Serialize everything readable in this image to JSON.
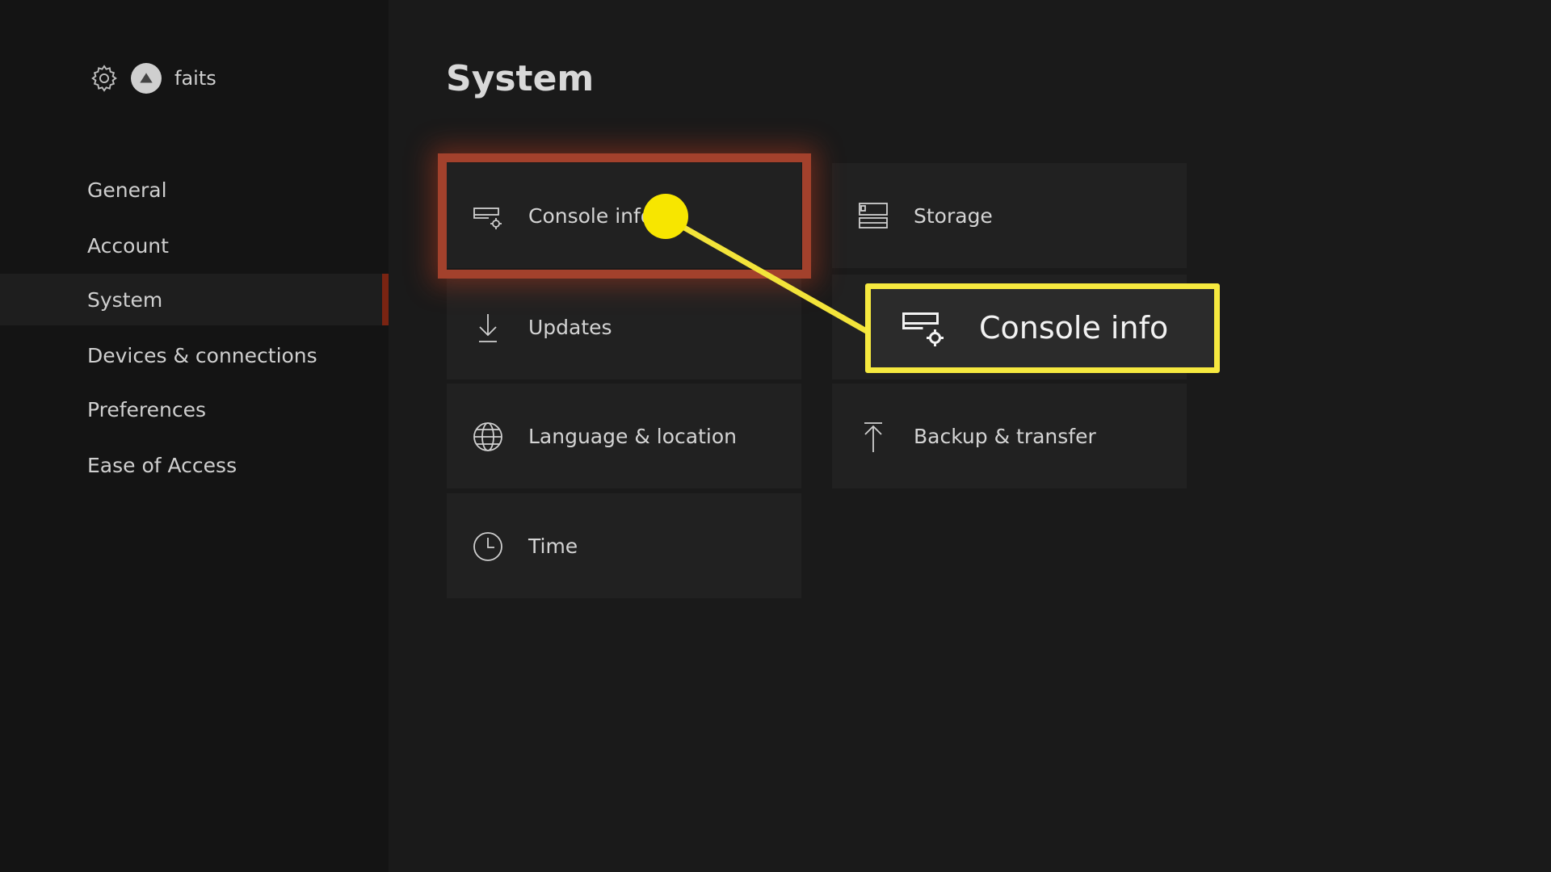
{
  "profile": {
    "username": "faits",
    "icons": [
      "gear-icon",
      "avatar"
    ]
  },
  "sidebar": {
    "items": [
      {
        "label": "General"
      },
      {
        "label": "Account"
      },
      {
        "label": "System",
        "selected": true
      },
      {
        "label": "Devices & connections"
      },
      {
        "label": "Preferences"
      },
      {
        "label": "Ease of Access"
      }
    ]
  },
  "main": {
    "title": "System",
    "tiles": [
      {
        "label": "Console info",
        "icon": "console-settings-icon"
      },
      {
        "label": "Storage",
        "icon": "storage-icon"
      },
      {
        "label": "Updates",
        "icon": "download-icon"
      },
      {
        "label": "Language & location",
        "icon": "globe-icon"
      },
      {
        "label": "Backup & transfer",
        "icon": "upload-icon"
      },
      {
        "label": "Time",
        "icon": "clock-icon"
      }
    ]
  },
  "annotation": {
    "callout_label": "Console info",
    "highlight_color": "#a3412c",
    "callout_color": "#f6e93f"
  }
}
